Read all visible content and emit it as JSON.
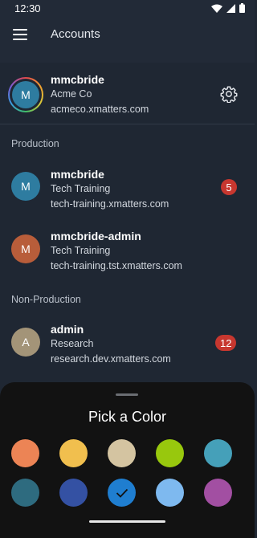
{
  "status_bar": {
    "time": "12:30"
  },
  "app_bar": {
    "title": "Accounts"
  },
  "current_account": {
    "initial": "M",
    "name": "mmcbride",
    "company": "Acme Co",
    "host": "acmeco.xmatters.com"
  },
  "sections": {
    "production": "Production",
    "non_production": "Non-Production"
  },
  "accounts": [
    {
      "initial": "M",
      "name": "mmcbride",
      "company": "Tech Training",
      "host": "tech-training.xmatters.com",
      "badge": "5",
      "color": "#2e7ca0"
    },
    {
      "initial": "M",
      "name": "mmcbride-admin",
      "company": "Tech Training",
      "host": "tech-training.tst.xmatters.com",
      "badge": "",
      "color": "#b85d3a"
    },
    {
      "initial": "A",
      "name": "admin",
      "company": "Research",
      "host": "research.dev.xmatters.com",
      "badge": "12",
      "color": "#a39478"
    }
  ],
  "color_picker": {
    "title": "Pick a Color",
    "colors": [
      "#ec8455",
      "#f1bf4e",
      "#d4c4a1",
      "#98c80d",
      "#45a0b9",
      "#2e6b7f",
      "#3451a3",
      "#1f7ed0",
      "#7eb9ef",
      "#a24fa2"
    ],
    "selected_index": 7
  }
}
